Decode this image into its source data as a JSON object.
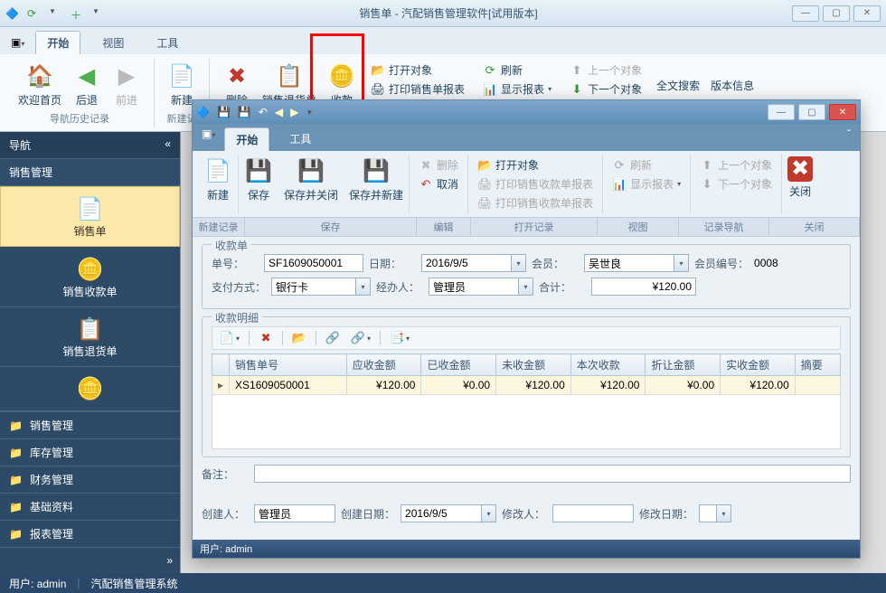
{
  "outer": {
    "title": "销售单 - 汽配销售管理软件[试用版本]",
    "tabs": [
      "开始",
      "视图",
      "工具"
    ],
    "ribbon": {
      "welcome": "欢迎首页",
      "back": "后退",
      "forward": "前进",
      "new": "新建",
      "delete": "删除",
      "return": "销售退货单",
      "receipt": "收款",
      "open_obj": "打开对象",
      "print_report": "打印销售单报表",
      "refresh": "刷新",
      "show_report": "显示报表",
      "prev_obj": "上一个对象",
      "next_obj": "下一个对象",
      "fulltext": "全文搜索",
      "version": "版本信息",
      "group_nav": "导航历史记录",
      "group_new": "新建记"
    }
  },
  "left": {
    "title": "导航",
    "section": "销售管理",
    "items": [
      "销售单",
      "销售收款单",
      "销售退货单"
    ],
    "sections": [
      "销售管理",
      "库存管理",
      "财务管理",
      "基础资料",
      "报表管理"
    ]
  },
  "status": {
    "user_label": "用户:",
    "user": "admin",
    "sys": "汽配销售管理系统"
  },
  "inner": {
    "tabs": [
      "开始",
      "工具"
    ],
    "ribbon": {
      "new": "新建",
      "save": "保存",
      "save_close": "保存并关闭",
      "save_new": "保存并新建",
      "delete": "删除",
      "cancel": "取消",
      "open_obj": "打开对象",
      "print_receipt": "打印销售收款单报表",
      "print_receipt2": "打印销售收款单报表",
      "refresh": "刷新",
      "show_report": "显示报表",
      "prev_obj": "上一个对象",
      "next_obj": "下一个对象",
      "close": "关闭",
      "g_new": "新建记录",
      "g_save": "保存",
      "g_edit": "编辑",
      "g_open": "打开记录",
      "g_view": "视图",
      "g_recnav": "记录导航",
      "g_close": "关闭"
    },
    "form": {
      "legend": "收款单",
      "orderno_label": "单号：",
      "orderno": "SF1609050001",
      "date_label": "日期：",
      "date": "2016/9/5",
      "member_label": "会员：",
      "member": "吴世良",
      "memberno_label": "会员编号：",
      "memberno": "0008",
      "paytype_label": "支付方式：",
      "paytype": "银行卡",
      "handler_label": "经办人：",
      "handler": "管理员",
      "total_label": "合计：",
      "total": "¥120.00"
    },
    "detail": {
      "legend": "收款明细",
      "cols": [
        "销售单号",
        "应收金额",
        "已收金额",
        "未收金额",
        "本次收款",
        "折让金额",
        "实收金额",
        "摘要"
      ],
      "row": {
        "no": "XS1609050001",
        "due": "¥120.00",
        "recv": "¥0.00",
        "unrecv": "¥120.00",
        "thistime": "¥120.00",
        "discount": "¥0.00",
        "actual": "¥120.00",
        "note": ""
      }
    },
    "remark_label": "备注：",
    "footer": {
      "creator_label": "创建人：",
      "creator": "管理员",
      "create_date_label": "创建日期：",
      "create_date": "2016/9/5",
      "modifier_label": "修改人：",
      "modifier": "",
      "modify_date_label": "修改日期："
    },
    "status_user_label": "用户:",
    "status_user": "admin"
  }
}
